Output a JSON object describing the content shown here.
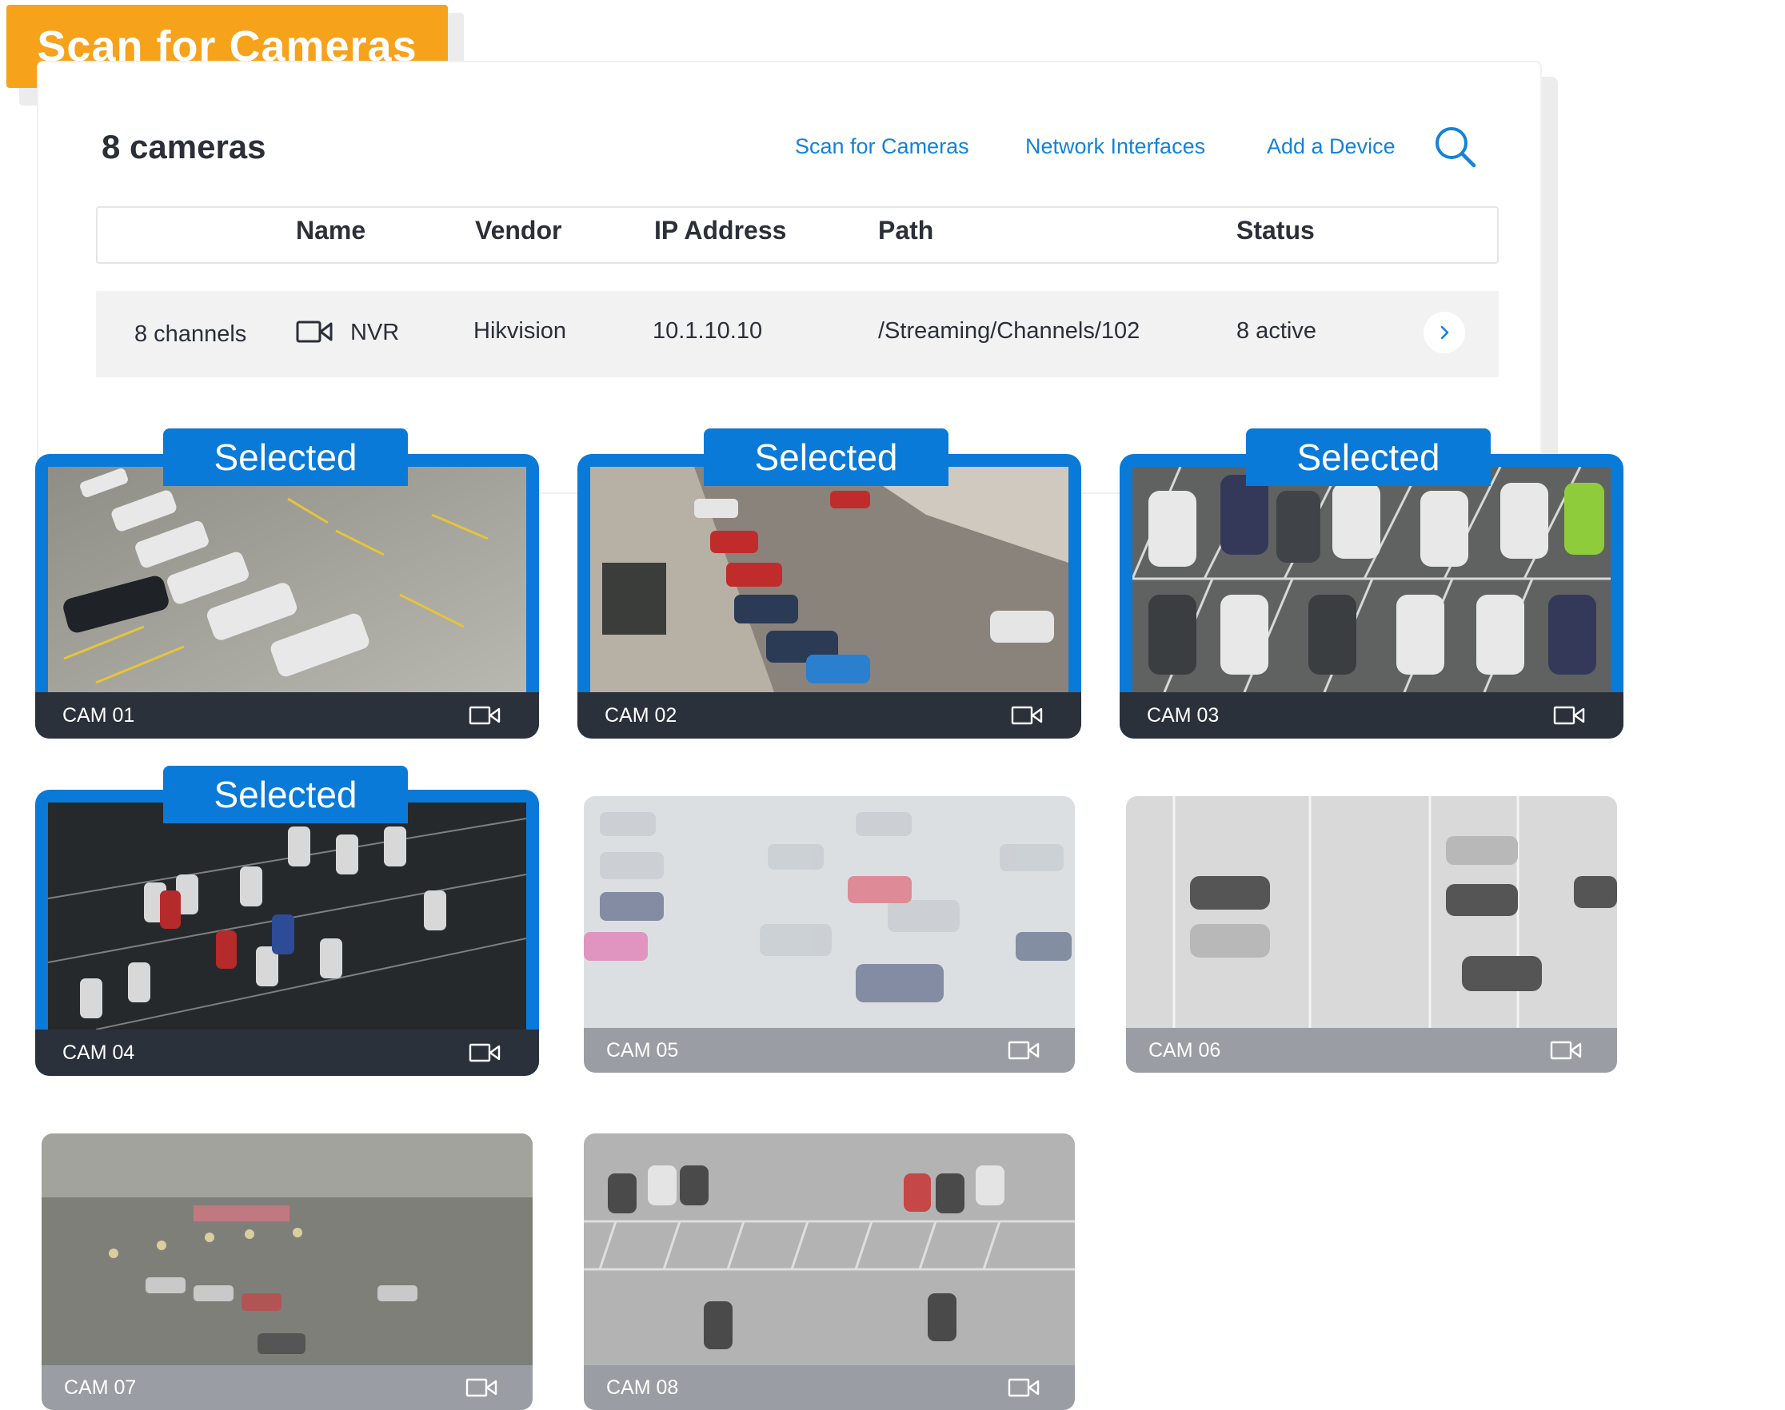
{
  "badge": {
    "label": "Scan for Cameras",
    "color": "#f7a21b"
  },
  "header": {
    "count": "8 cameras",
    "links": [
      "Scan for Cameras",
      "Network Interfaces",
      "Add a Device"
    ],
    "search_icon": "search-icon",
    "accent": "#1482d8"
  },
  "table": {
    "columns": [
      "Name",
      "Vendor",
      "IP Address",
      "Path",
      "Status"
    ],
    "row": {
      "channels": "8 channels",
      "icon": "video-camera-icon",
      "name": "NVR",
      "vendor": "Hikvision",
      "ip": "10.1.10.10",
      "path": "/Streaming/Channels/102",
      "status": "8 active",
      "action_icon": "chevron-right-icon"
    }
  },
  "cameras": [
    {
      "label": "CAM 01",
      "selected": true,
      "tag": "Selected"
    },
    {
      "label": "CAM 02",
      "selected": true,
      "tag": "Selected"
    },
    {
      "label": "CAM 03",
      "selected": true,
      "tag": "Selected"
    },
    {
      "label": "CAM 04",
      "selected": true,
      "tag": "Selected"
    },
    {
      "label": "CAM 05",
      "selected": false
    },
    {
      "label": "CAM 06",
      "selected": false
    },
    {
      "label": "CAM 07",
      "selected": false
    },
    {
      "label": "CAM 08",
      "selected": false
    }
  ],
  "colors": {
    "selected": "#0a7ad8",
    "bar_dark": "#2b313b",
    "bar_grey": "#9a9da3"
  }
}
